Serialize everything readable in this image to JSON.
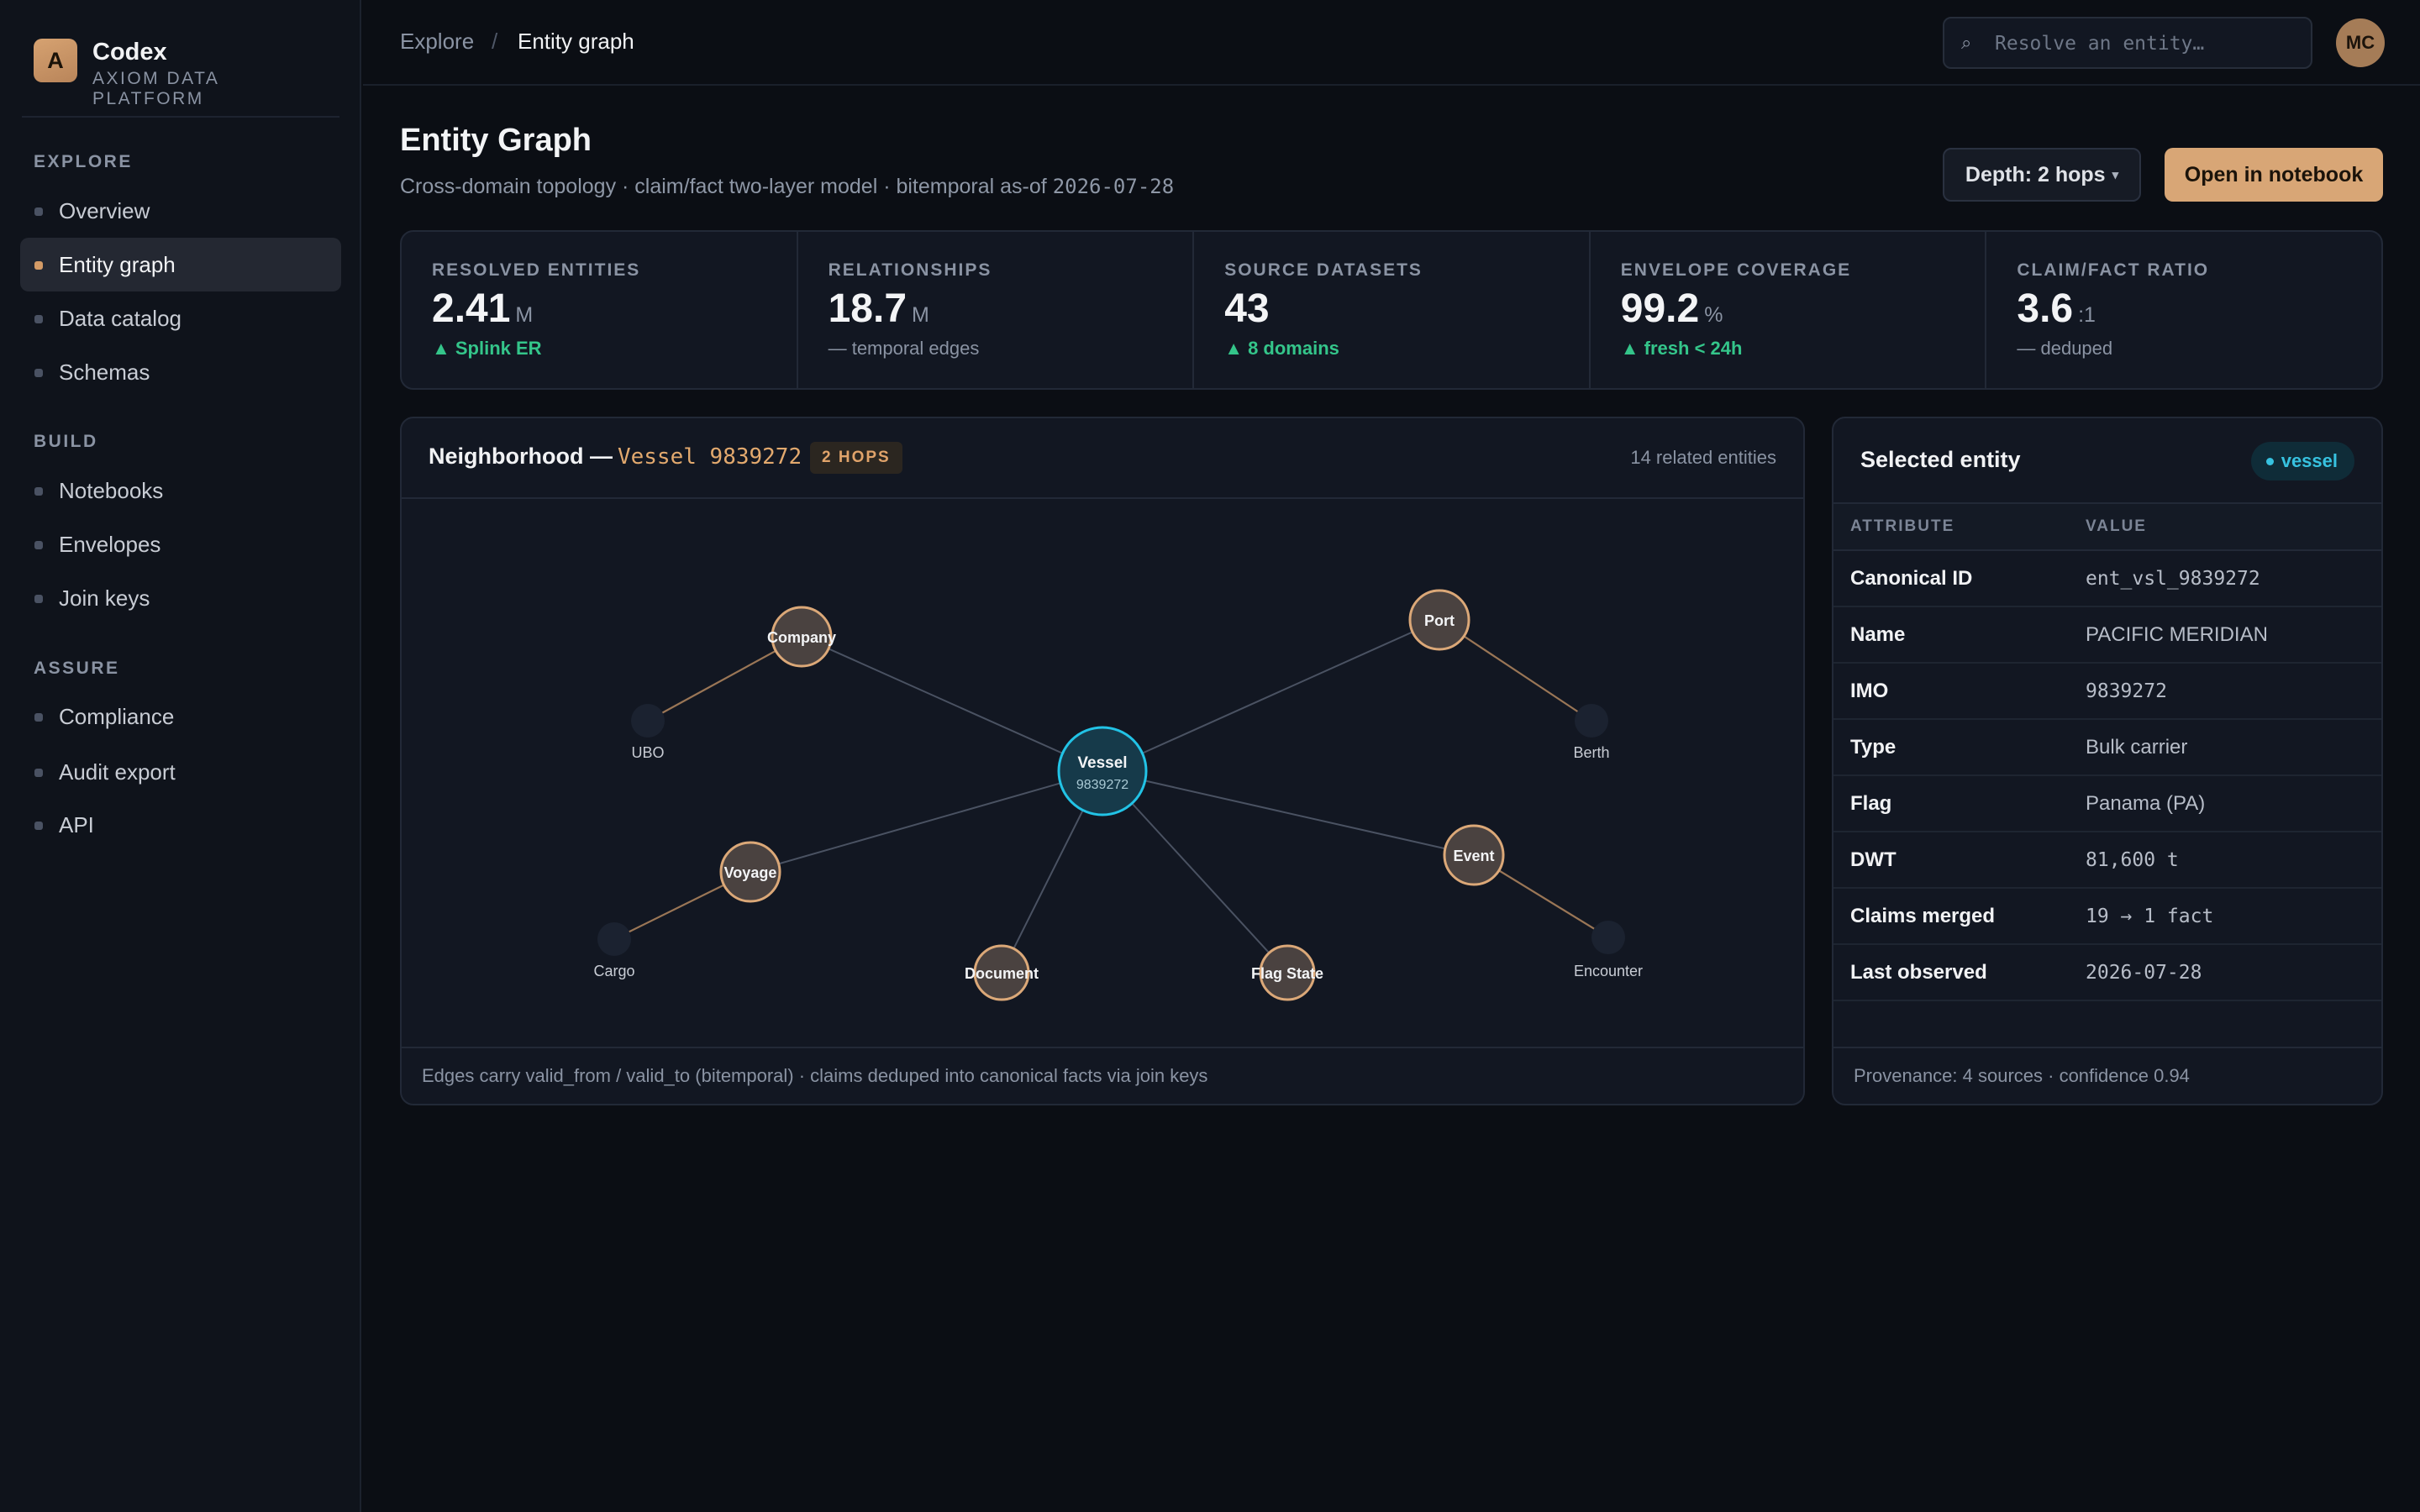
{
  "brand": {
    "logo_letter": "A",
    "name": "Codex",
    "subtitle": "AXIOM DATA PLATFORM"
  },
  "sidebar": {
    "sections": [
      {
        "label": "EXPLORE",
        "items": [
          {
            "label": "Overview",
            "active": false
          },
          {
            "label": "Entity graph",
            "active": true
          },
          {
            "label": "Data catalog",
            "active": false
          },
          {
            "label": "Schemas",
            "active": false
          }
        ]
      },
      {
        "label": "BUILD",
        "items": [
          {
            "label": "Notebooks",
            "active": false
          },
          {
            "label": "Envelopes",
            "active": false
          },
          {
            "label": "Join keys",
            "active": false
          }
        ]
      },
      {
        "label": "ASSURE",
        "items": [
          {
            "label": "Compliance",
            "active": false
          },
          {
            "label": "Audit export",
            "active": false
          },
          {
            "label": "API",
            "active": false
          }
        ]
      }
    ]
  },
  "topbar": {
    "breadcrumb": {
      "root": "Explore",
      "separator": "/",
      "current": "Entity graph"
    },
    "search": {
      "placeholder": "Resolve an entity…",
      "icon": "search-icon"
    },
    "avatar_initials": "MC"
  },
  "page": {
    "title": "Entity Graph",
    "subtitle_text": "Cross-domain topology · claim/fact two-layer model · bitemporal as-of ",
    "subtitle_date": "2026-07-28",
    "depth_label": "Depth: 2 hops",
    "depth_caret": "▾",
    "open_notebook_label": "Open in notebook"
  },
  "stats": [
    {
      "label": "RESOLVED ENTITIES",
      "value": "2.41",
      "unit": "M",
      "note": "▲ Splink ER",
      "trend": "up"
    },
    {
      "label": "RELATIONSHIPS",
      "value": "18.7",
      "unit": "M",
      "note": "— temporal edges",
      "trend": "flat"
    },
    {
      "label": "SOURCE DATASETS",
      "value": "43",
      "unit": "",
      "note": "▲ 8 domains",
      "trend": "up"
    },
    {
      "label": "ENVELOPE COVERAGE",
      "value": "99.2",
      "unit": "%",
      "note": "▲ fresh < 24h",
      "trend": "up"
    },
    {
      "label": "CLAIM/FACT RATIO",
      "value": "3.6",
      "unit": ":1",
      "note": "— deduped",
      "trend": "flat"
    }
  ],
  "graph": {
    "title_prefix": "Neighborhood —",
    "entity_label": "Vessel 9839272",
    "hops_badge": "2 HOPS",
    "related_count": "14 related entities",
    "footer": "Edges carry valid_from / valid_to (bitemporal) · claims deduped into canonical facts via join keys",
    "colors": {
      "center": "#22c3e6",
      "primary": "#dba878",
      "edge_primary": "#4a5262",
      "edge_secondary": "#9a7656"
    },
    "center": {
      "id": "vessel",
      "label": "Vessel",
      "sublabel": "9839272"
    },
    "primary_nodes": [
      {
        "id": "company",
        "label": "Company"
      },
      {
        "id": "port",
        "label": "Port"
      },
      {
        "id": "voyage",
        "label": "Voyage"
      },
      {
        "id": "event",
        "label": "Event"
      },
      {
        "id": "document",
        "label": "Document"
      },
      {
        "id": "flagstate",
        "label": "Flag State"
      }
    ],
    "secondary_nodes": [
      {
        "id": "ubo",
        "label": "UBO",
        "parent": "company"
      },
      {
        "id": "berth",
        "label": "Berth",
        "parent": "port"
      },
      {
        "id": "cargo",
        "label": "Cargo",
        "parent": "voyage"
      },
      {
        "id": "encounter",
        "label": "Encounter",
        "parent": "event"
      }
    ]
  },
  "entity": {
    "title": "Selected entity",
    "type_badge": "vessel",
    "columns": {
      "attribute": "ATTRIBUTE",
      "value": "VALUE"
    },
    "rows": [
      {
        "attribute": "Canonical ID",
        "value": "ent_vsl_9839272",
        "mono": true
      },
      {
        "attribute": "Name",
        "value": "PACIFIC MERIDIAN",
        "mono": false
      },
      {
        "attribute": "IMO",
        "value": "9839272",
        "mono": true
      },
      {
        "attribute": "Type",
        "value": "Bulk carrier",
        "mono": false
      },
      {
        "attribute": "Flag",
        "value": "Panama (PA)",
        "mono": false
      },
      {
        "attribute": "DWT",
        "value": "81,600 t",
        "mono": true
      },
      {
        "attribute": "Claims merged",
        "value": "19 → 1 fact",
        "mono": true
      },
      {
        "attribute": "Last observed",
        "value": "2026-07-28",
        "mono": true
      }
    ],
    "footer": "Provenance: 4 sources · confidence 0.94"
  }
}
